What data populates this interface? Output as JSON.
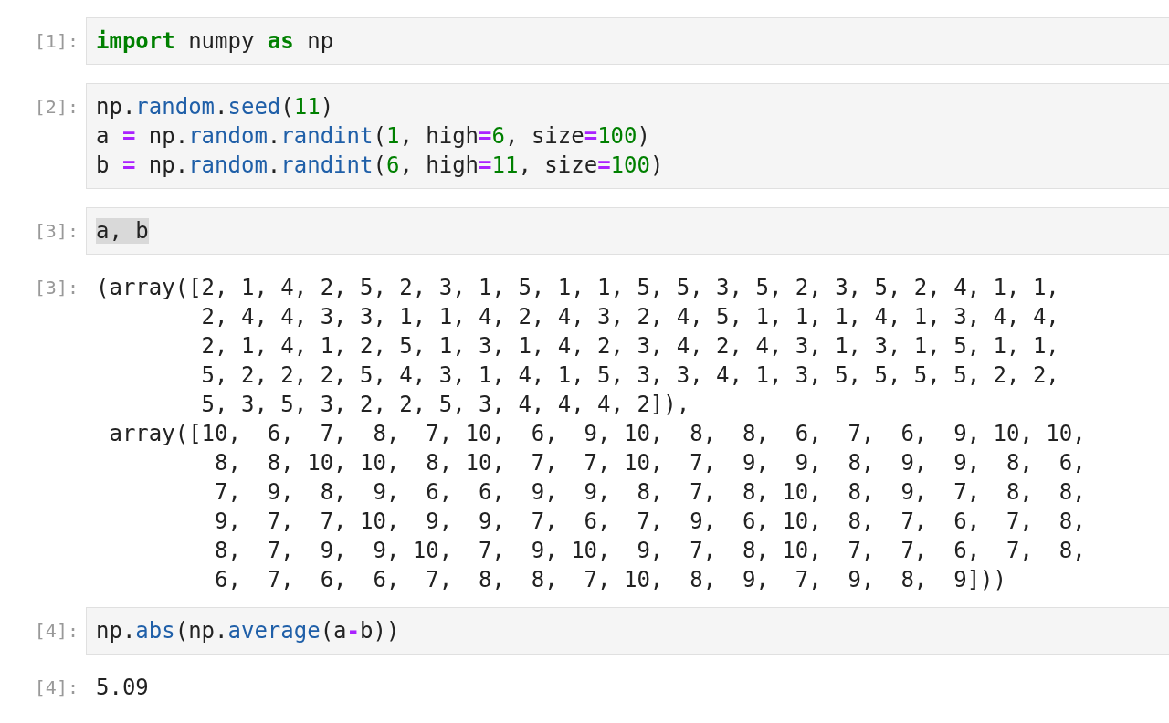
{
  "cells": [
    {
      "kind": "code",
      "prompt": "[1]:",
      "lines": [
        [
          {
            "kind": "kw",
            "text": "import"
          },
          {
            "kind": "plain",
            "text": " numpy "
          },
          {
            "kind": "kw",
            "text": "as"
          },
          {
            "kind": "plain",
            "text": " np"
          }
        ]
      ]
    },
    {
      "kind": "code",
      "prompt": "[2]:",
      "lines": [
        [
          {
            "kind": "plain",
            "text": "np."
          },
          {
            "kind": "fn",
            "text": "random"
          },
          {
            "kind": "plain",
            "text": "."
          },
          {
            "kind": "fn",
            "text": "seed"
          },
          {
            "kind": "plain",
            "text": "("
          },
          {
            "kind": "num",
            "text": "11"
          },
          {
            "kind": "plain",
            "text": ")"
          }
        ],
        [
          {
            "kind": "plain",
            "text": "a "
          },
          {
            "kind": "op",
            "text": "="
          },
          {
            "kind": "plain",
            "text": " np."
          },
          {
            "kind": "fn",
            "text": "random"
          },
          {
            "kind": "plain",
            "text": "."
          },
          {
            "kind": "fn",
            "text": "randint"
          },
          {
            "kind": "plain",
            "text": "("
          },
          {
            "kind": "num",
            "text": "1"
          },
          {
            "kind": "plain",
            "text": ", high"
          },
          {
            "kind": "op",
            "text": "="
          },
          {
            "kind": "num",
            "text": "6"
          },
          {
            "kind": "plain",
            "text": ", size"
          },
          {
            "kind": "op",
            "text": "="
          },
          {
            "kind": "num",
            "text": "100"
          },
          {
            "kind": "plain",
            "text": ")"
          }
        ],
        [
          {
            "kind": "plain",
            "text": "b "
          },
          {
            "kind": "op",
            "text": "="
          },
          {
            "kind": "plain",
            "text": " np."
          },
          {
            "kind": "fn",
            "text": "random"
          },
          {
            "kind": "plain",
            "text": "."
          },
          {
            "kind": "fn",
            "text": "randint"
          },
          {
            "kind": "plain",
            "text": "("
          },
          {
            "kind": "num",
            "text": "6"
          },
          {
            "kind": "plain",
            "text": ", high"
          },
          {
            "kind": "op",
            "text": "="
          },
          {
            "kind": "num",
            "text": "11"
          },
          {
            "kind": "plain",
            "text": ", size"
          },
          {
            "kind": "op",
            "text": "="
          },
          {
            "kind": "num",
            "text": "100"
          },
          {
            "kind": "plain",
            "text": ")"
          }
        ]
      ]
    },
    {
      "kind": "code",
      "prompt": "[3]:",
      "lines": [
        [
          {
            "kind": "highlight",
            "text": "a, b"
          }
        ]
      ]
    },
    {
      "kind": "output",
      "prompt": "[3]:",
      "lines": [
        "(array([2, 1, 4, 2, 5, 2, 3, 1, 5, 1, 1, 5, 5, 3, 5, 2, 3, 5, 2, 4, 1, 1,",
        "        2, 4, 4, 3, 3, 1, 1, 4, 2, 4, 3, 2, 4, 5, 1, 1, 1, 4, 1, 3, 4, 4,",
        "        2, 1, 4, 1, 2, 5, 1, 3, 1, 4, 2, 3, 4, 2, 4, 3, 1, 3, 1, 5, 1, 1,",
        "        5, 2, 2, 2, 5, 4, 3, 1, 4, 1, 5, 3, 3, 4, 1, 3, 5, 5, 5, 5, 2, 2,",
        "        5, 3, 5, 3, 2, 2, 5, 3, 4, 4, 4, 2]),",
        " array([10,  6,  7,  8,  7, 10,  6,  9, 10,  8,  8,  6,  7,  6,  9, 10, 10,",
        "         8,  8, 10, 10,  8, 10,  7,  7, 10,  7,  9,  9,  8,  9,  9,  8,  6,",
        "         7,  9,  8,  9,  6,  6,  9,  9,  8,  7,  8, 10,  8,  9,  7,  8,  8,",
        "         9,  7,  7, 10,  9,  9,  7,  6,  7,  9,  6, 10,  8,  7,  6,  7,  8,",
        "         8,  7,  9,  9, 10,  7,  9, 10,  9,  7,  8, 10,  7,  7,  6,  7,  8,",
        "         6,  7,  6,  6,  7,  8,  8,  7, 10,  8,  9,  7,  9,  8,  9]))"
      ]
    },
    {
      "kind": "code",
      "prompt": "[4]:",
      "lines": [
        [
          {
            "kind": "plain",
            "text": "np."
          },
          {
            "kind": "fn",
            "text": "abs"
          },
          {
            "kind": "plain",
            "text": "(np."
          },
          {
            "kind": "fn",
            "text": "average"
          },
          {
            "kind": "plain",
            "text": "(a"
          },
          {
            "kind": "op",
            "text": "-"
          },
          {
            "kind": "plain",
            "text": "b))"
          }
        ]
      ]
    },
    {
      "kind": "output",
      "prompt": "[4]:",
      "lines": [
        "5.09"
      ]
    }
  ]
}
